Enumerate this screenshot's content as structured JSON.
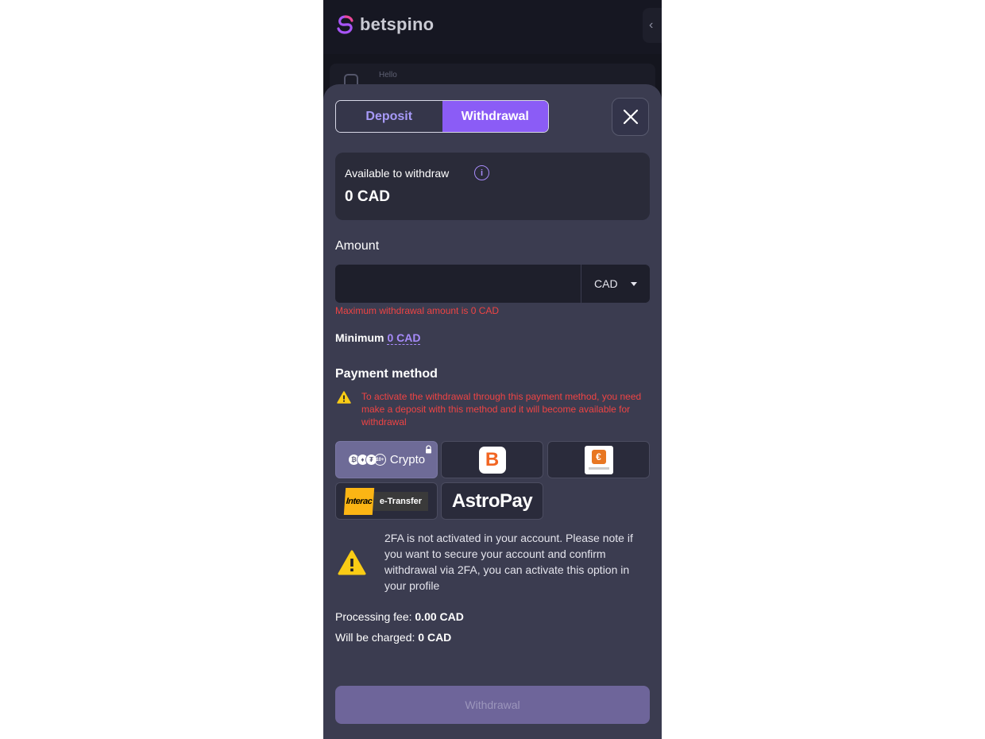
{
  "header": {
    "brand": "betspino",
    "greeting": "Hello"
  },
  "tabs": {
    "deposit": "Deposit",
    "withdrawal": "Withdrawal"
  },
  "available": {
    "label": "Available to withdraw",
    "info_glyph": "i",
    "value": "0 CAD"
  },
  "amount": {
    "label": "Amount",
    "value": "",
    "currency": "CAD",
    "error": "Maximum withdrawal amount is 0 CAD",
    "minimum_label": "Minimum",
    "minimum_value": "0 CAD"
  },
  "payment": {
    "label": "Payment method",
    "warning": "To activate the withdrawal through this payment method, you need make a deposit with this method and it will become available for withdrawal",
    "methods": [
      {
        "name": "Crypto",
        "icon": "crypto-coins-icon",
        "locked": true,
        "selected": true
      },
      {
        "name": "",
        "icon": "b-logo",
        "locked": false,
        "selected": false
      },
      {
        "name": "",
        "icon": "e-wallet-logo",
        "locked": false,
        "selected": false
      },
      {
        "name": "e-Transfer",
        "brand": "Interac",
        "icon": "interac-logo",
        "locked": false,
        "selected": false
      },
      {
        "name": "AstroPay",
        "icon": "astropay-logo",
        "locked": false,
        "selected": false
      }
    ],
    "coin_glyphs": [
      "₿",
      "♦",
      "₮",
      "10+"
    ]
  },
  "twofa": {
    "message": "2FA is not activated in your account. Please note if you want to secure your account and confirm withdrawal via 2FA, you can activate this option in your profile"
  },
  "summary": {
    "fee_label": "Processing fee:",
    "fee_value": "0.00 CAD",
    "charged_label": "Will be charged:",
    "charged_value": "0 CAD"
  },
  "submit": {
    "label": "Withdrawal"
  },
  "colors": {
    "accent": "#8b5cf6",
    "modal_bg": "#3b3c50",
    "error": "#ef4444",
    "warning": "#facc15"
  }
}
